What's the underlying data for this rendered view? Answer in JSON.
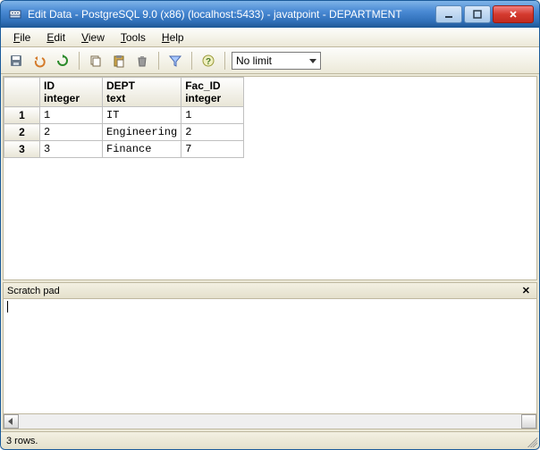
{
  "window": {
    "title": "Edit Data - PostgreSQL 9.0 (x86) (localhost:5433) - javatpoint - DEPARTMENT"
  },
  "menus": {
    "file": "File",
    "edit": "Edit",
    "view": "View",
    "tools": "Tools",
    "help": "Help"
  },
  "toolbar": {
    "limit_label": "No limit"
  },
  "grid": {
    "columns": [
      {
        "name": "ID",
        "type": "integer"
      },
      {
        "name": "DEPT",
        "type": "text"
      },
      {
        "name": "Fac_ID",
        "type": "integer"
      }
    ],
    "rows": [
      {
        "n": "1",
        "id": "1",
        "dept": "IT",
        "fac": "1"
      },
      {
        "n": "2",
        "id": "2",
        "dept": "Engineering",
        "fac": "2"
      },
      {
        "n": "3",
        "id": "3",
        "dept": "Finance",
        "fac": "7"
      }
    ]
  },
  "scratch": {
    "title": "Scratch pad",
    "content": ""
  },
  "status": {
    "text": "3 rows."
  }
}
